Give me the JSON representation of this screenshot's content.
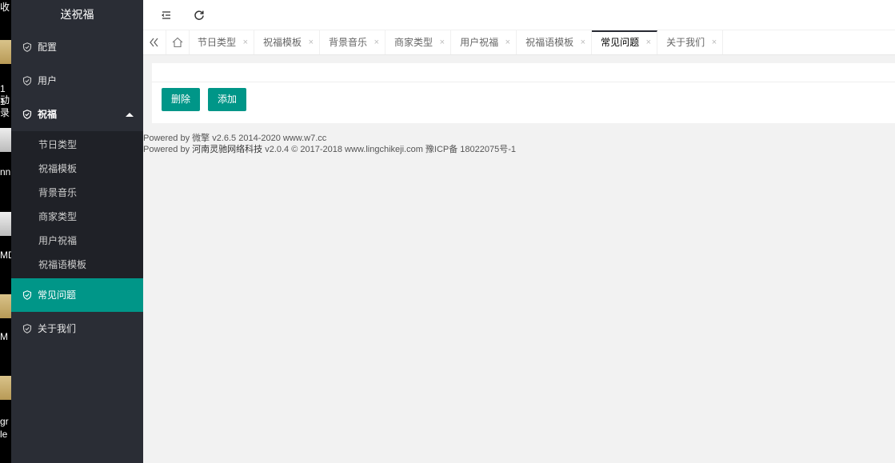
{
  "desktop": {
    "fragments": [
      "收",
      "1动",
      "1录",
      "nn",
      "MD",
      "M",
      "gr",
      "le"
    ]
  },
  "sidebar": {
    "brand": "送祝福",
    "items": [
      {
        "label": "配置"
      },
      {
        "label": "用户"
      },
      {
        "label": "祝福"
      }
    ],
    "submenu": [
      "节日类型",
      "祝福模板",
      "背景音乐",
      "商家类型",
      "用户祝福",
      "祝福语模板"
    ],
    "bottom_items": [
      {
        "label": "常见问题"
      },
      {
        "label": "关于我们"
      }
    ]
  },
  "tabs": [
    "节日类型",
    "祝福模板",
    "背景音乐",
    "商家类型",
    "用户祝福",
    "祝福语模板",
    "常见问题",
    "关于我们"
  ],
  "tab_close": "×",
  "toolbar": {
    "delete_label": "删除",
    "add_label": "添加"
  },
  "footer": {
    "line1": "Powered by 微擎 v2.6.5 2014-2020 www.w7.cc",
    "line2_prefix": "Powered by ",
    "line2_brand": "河南灵驰网络科技",
    "line2_suffix": " v2.0.4 © 2017-2018 www.lingchikeji.com 豫ICP备 18022075号-1"
  },
  "colors": {
    "sidebar_bg": "#2a2d35",
    "accent": "#009688",
    "submenu_bg": "#1f2127"
  }
}
